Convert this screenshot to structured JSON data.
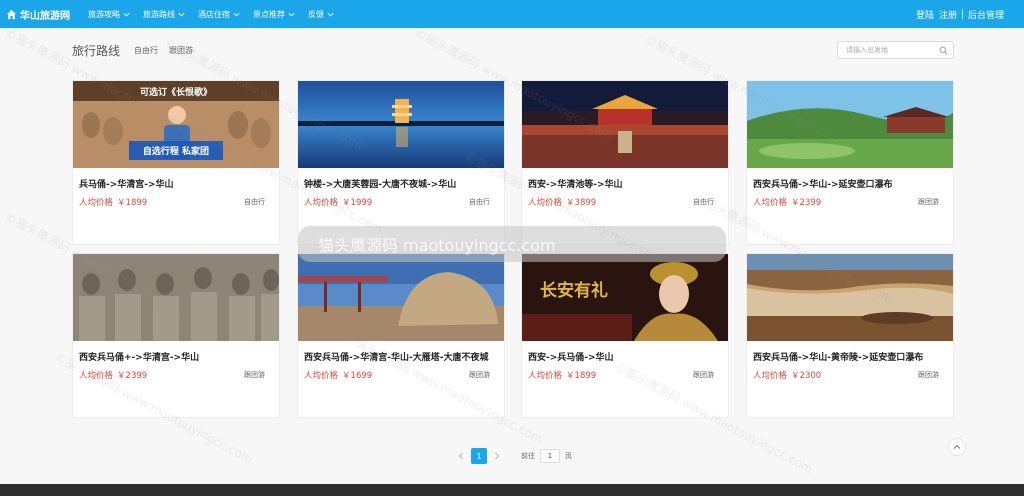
{
  "header": {
    "brand": "华山旅游网",
    "nav": [
      {
        "label": "旅游攻略"
      },
      {
        "label": "旅游路线"
      },
      {
        "label": "酒店住宿"
      },
      {
        "label": "景点推荐"
      },
      {
        "label": "反馈"
      }
    ],
    "login": "登陆",
    "register": "注册",
    "admin": "后台管理"
  },
  "page": {
    "title": "旅行路线",
    "tabs": [
      "自由行",
      "跟团游"
    ],
    "search_placeholder": "请输入出发地"
  },
  "price_label": "人均价格",
  "currency": "￥",
  "routes": [
    {
      "title": "兵马俑->华清宫->华山",
      "price": "1899",
      "type": "自由行",
      "image_caption": "可选订《长恨歌》",
      "image_subcaption": "自选行程 私家团"
    },
    {
      "title": "钟楼->大唐芙蓉园-大唐不夜城->华山",
      "price": "1999",
      "type": "自由行"
    },
    {
      "title": "西安->华清池等->华山",
      "price": "3899",
      "type": "自由行"
    },
    {
      "title": "西安兵马俑->华山->延安壶口瀑布",
      "price": "2399",
      "type": "跟团游"
    },
    {
      "title": "西安兵马俑+->华清宫->华山",
      "price": "2399",
      "type": "跟团游"
    },
    {
      "title": "西安兵马俑->华清宫-华山-大雁塔-大唐不夜城",
      "price": "1699",
      "type": "跟团游"
    },
    {
      "title": "西安->兵马俑->华山",
      "price": "1899",
      "type": "跟团游",
      "image_caption": "长安有礼"
    },
    {
      "title": "西安兵马俑->华山-黄帝陵->延安壶口瀑布",
      "price": "2300",
      "type": "跟团游"
    }
  ],
  "banner": "猫头鹰源码 maotouyingcc.com",
  "watermark": "©猫头鹰源码 www.maotouyingcc.com",
  "pagination": {
    "current": "1",
    "goto_label": "前往",
    "goto_value": "1",
    "page_suffix": "页"
  },
  "colors": {
    "nav_bg": "#1aa6e8",
    "price": "#e0463b",
    "page_active": "#1aa6e8"
  }
}
